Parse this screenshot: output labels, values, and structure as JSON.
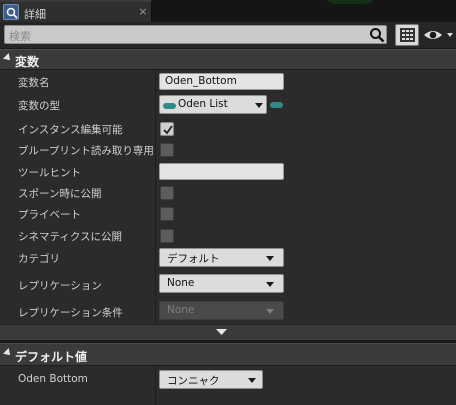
{
  "tab": {
    "title": "詳細",
    "close": "×"
  },
  "search": {
    "placeholder": "検索"
  },
  "variables_section": {
    "title": "変数",
    "rows": [
      {
        "label": "変数名",
        "value": "Oden_Bottom"
      },
      {
        "label": "変数の型",
        "value": "Oden List"
      },
      {
        "label": "インスタンス編集可能",
        "checked": true
      },
      {
        "label": "ブループリント読み取り専用",
        "checked": false
      },
      {
        "label": "ツールヒント",
        "value": ""
      },
      {
        "label": "スポーン時に公開",
        "checked": false
      },
      {
        "label": "プライベート",
        "checked": false
      },
      {
        "label": "シネマティクスに公開",
        "checked": false
      },
      {
        "label": "カテゴリ",
        "value": "デフォルト"
      },
      {
        "label": "レプリケーション",
        "value": "None"
      },
      {
        "label": "レプリケーション条件",
        "value": "None"
      }
    ]
  },
  "defaults_section": {
    "title": "デフォルト値",
    "rows": [
      {
        "label": "Oden Bottom",
        "value": "コンニャク"
      }
    ]
  },
  "colors": {
    "type_pill": "#2e8c86"
  }
}
